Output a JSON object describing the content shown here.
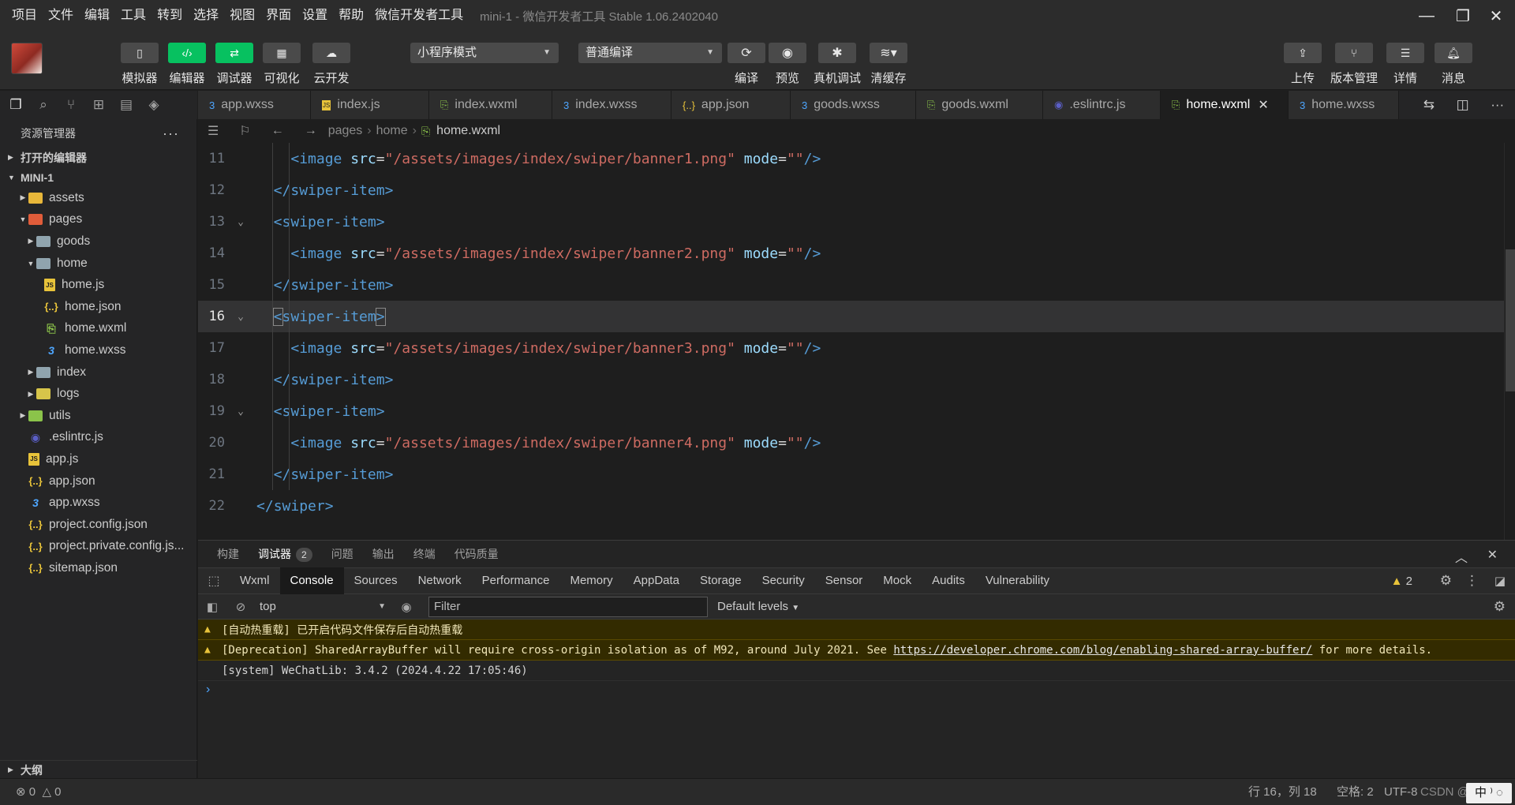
{
  "menubar": {
    "items": [
      "项目",
      "文件",
      "编辑",
      "工具",
      "转到",
      "选择",
      "视图",
      "界面",
      "设置",
      "帮助",
      "微信开发者工具"
    ],
    "title": "mini-1 - 微信开发者工具 Stable 1.06.2402040"
  },
  "toolbar": {
    "simulator": "模拟器",
    "editor": "编辑器",
    "debugger": "调试器",
    "visual": "可视化",
    "cloud": "云开发",
    "mode_select": "小程序模式",
    "compile_select": "普通编译",
    "compile": "编译",
    "preview": "预览",
    "device_debug": "真机调试",
    "clear_cache": "清缓存",
    "upload": "上传",
    "version": "版本管理",
    "details": "详情",
    "messages": "消息"
  },
  "sidebar": {
    "title": "资源管理器",
    "open_editors": "打开的编辑器",
    "project": "MINI-1",
    "tree": [
      {
        "label": "assets",
        "depth": 1,
        "twisty": "▸",
        "icon": "folder"
      },
      {
        "label": "pages",
        "depth": 1,
        "twisty": "▾",
        "icon": "folder-pages"
      },
      {
        "label": "goods",
        "depth": 2,
        "twisty": "▸",
        "icon": "folder-plain"
      },
      {
        "label": "home",
        "depth": 2,
        "twisty": "▾",
        "icon": "folder-plain"
      },
      {
        "label": "home.js",
        "depth": 3,
        "twisty": "",
        "icon": "js"
      },
      {
        "label": "home.json",
        "depth": 3,
        "twisty": "",
        "icon": "json"
      },
      {
        "label": "home.wxml",
        "depth": 3,
        "twisty": "",
        "icon": "wxml"
      },
      {
        "label": "home.wxss",
        "depth": 3,
        "twisty": "",
        "icon": "wxss"
      },
      {
        "label": "index",
        "depth": 2,
        "twisty": "▸",
        "icon": "folder-plain"
      },
      {
        "label": "logs",
        "depth": 2,
        "twisty": "▸",
        "icon": "folder-logs"
      },
      {
        "label": "utils",
        "depth": 1,
        "twisty": "▸",
        "icon": "folder-utils"
      },
      {
        "label": ".eslintrc.js",
        "depth": 1,
        "twisty": "",
        "icon": "eslint"
      },
      {
        "label": "app.js",
        "depth": 1,
        "twisty": "",
        "icon": "js"
      },
      {
        "label": "app.json",
        "depth": 1,
        "twisty": "",
        "icon": "json"
      },
      {
        "label": "app.wxss",
        "depth": 1,
        "twisty": "",
        "icon": "wxss"
      },
      {
        "label": "project.config.json",
        "depth": 1,
        "twisty": "",
        "icon": "json"
      },
      {
        "label": "project.private.config.js...",
        "depth": 1,
        "twisty": "",
        "icon": "json"
      },
      {
        "label": "sitemap.json",
        "depth": 1,
        "twisty": "",
        "icon": "json"
      }
    ],
    "outline": "大纲"
  },
  "tabs": [
    {
      "label": "app.wxss",
      "icon": "wxss",
      "active": false
    },
    {
      "label": "index.js",
      "icon": "js",
      "active": false
    },
    {
      "label": "index.wxml",
      "icon": "wxml",
      "active": false
    },
    {
      "label": "index.wxss",
      "icon": "wxss",
      "active": false
    },
    {
      "label": "app.json",
      "icon": "json",
      "active": false
    },
    {
      "label": "goods.wxss",
      "icon": "wxss",
      "active": false
    },
    {
      "label": "goods.wxml",
      "icon": "wxml",
      "active": false
    },
    {
      "label": ".eslintrc.js",
      "icon": "eslint",
      "active": false
    },
    {
      "label": "home.wxml",
      "icon": "wxml",
      "active": true
    },
    {
      "label": "home.wxss",
      "icon": "wxss",
      "active": false
    }
  ],
  "breadcrumb": {
    "pages": "pages",
    "home": "home",
    "file": "home.wxml"
  },
  "editor": {
    "current_line": 16,
    "lines": [
      {
        "num": "11",
        "indent": 2,
        "kind": "image",
        "src": "/assets/images/index/swiper/banner1.png"
      },
      {
        "num": "12",
        "indent": 1,
        "kind": "close",
        "tag": "swiper-item"
      },
      {
        "num": "13",
        "indent": 1,
        "kind": "open",
        "tag": "swiper-item",
        "fold": true
      },
      {
        "num": "14",
        "indent": 2,
        "kind": "image",
        "src": "/assets/images/index/swiper/banner2.png"
      },
      {
        "num": "15",
        "indent": 1,
        "kind": "close",
        "tag": "swiper-item"
      },
      {
        "num": "16",
        "indent": 1,
        "kind": "open",
        "tag": "swiper-item",
        "fold": true,
        "current": true
      },
      {
        "num": "17",
        "indent": 2,
        "kind": "image",
        "src": "/assets/images/index/swiper/banner3.png"
      },
      {
        "num": "18",
        "indent": 1,
        "kind": "close",
        "tag": "swiper-item"
      },
      {
        "num": "19",
        "indent": 1,
        "kind": "open",
        "tag": "swiper-item",
        "fold": true
      },
      {
        "num": "20",
        "indent": 2,
        "kind": "image",
        "src": "/assets/images/index/swiper/banner4.png"
      },
      {
        "num": "21",
        "indent": 1,
        "kind": "close",
        "tag": "swiper-item"
      },
      {
        "num": "22",
        "indent": 0,
        "kind": "close",
        "tag": "swiper"
      }
    ]
  },
  "panel": {
    "tabs": [
      "构建",
      "调试器",
      "问题",
      "输出",
      "终端",
      "代码质量"
    ],
    "debugger_badge": "2",
    "devtools_tabs": [
      "Wxml",
      "Console",
      "Sources",
      "Network",
      "Performance",
      "Memory",
      "AppData",
      "Storage",
      "Security",
      "Sensor",
      "Mock",
      "Audits",
      "Vulnerability"
    ],
    "active_devtools_tab": "Console",
    "warning_count": "2",
    "context": "top",
    "filter_placeholder": "Filter",
    "levels": "Default levels",
    "messages": {
      "hot_reload": "[自动热重载] 已开启代码文件保存后自动热重载",
      "deprecation_prefix": "[Deprecation] SharedArrayBuffer will require cross-origin isolation as of M92, around July 2021. See ",
      "deprecation_link": "https://developer.chrome.com/blog/enabling-shared-array-buffer/",
      "deprecation_suffix": " for more details.",
      "system": "[system] WeChatLib: 3.4.2 (2024.4.22 17:05:46)"
    },
    "prompt": "›"
  },
  "statusbar": {
    "errors": "0",
    "warnings": "0",
    "position": "行 16，列 18",
    "spaces": "空格: 2",
    "encoding": "UTF-8",
    "watermark": "CSDN @",
    "ime": "中 ⁾ ◌"
  },
  "colors": {
    "accent_green": "#07c160",
    "tag_blue": "#569cd6",
    "string_red": "#ce6b62"
  }
}
